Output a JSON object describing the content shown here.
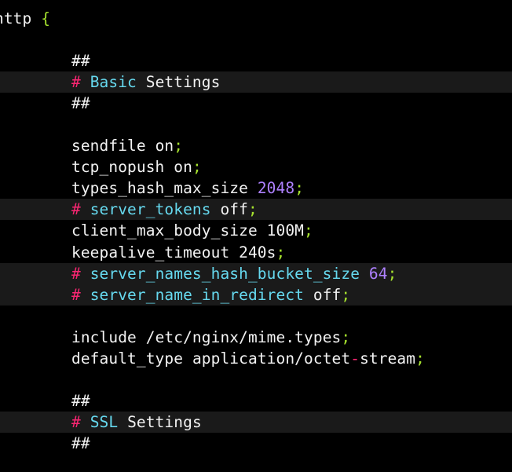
{
  "editor": {
    "lines": {
      "l1": {
        "text": "http",
        "brace": "{"
      },
      "l3": {
        "text": "##"
      },
      "l4": {
        "hash": "#",
        "kw": "Basic",
        "rest": "Settings"
      },
      "l5": {
        "text": "##"
      },
      "l7": {
        "name": "sendfile",
        "value": "on",
        "semi": ";"
      },
      "l8": {
        "name": "tcp_nopush",
        "value": "on",
        "semi": ";"
      },
      "l9": {
        "name": "types_hash_max_size",
        "value": "2048",
        "semi": ";"
      },
      "l10": {
        "hash": "#",
        "kw": "server_tokens",
        "value": "off",
        "semi": ";"
      },
      "l11": {
        "name": "client_max_body_size",
        "value": "100M",
        "semi": ";"
      },
      "l12": {
        "name": "keepalive_timeout",
        "value": "240s",
        "semi": ";"
      },
      "l13": {
        "hash": "#",
        "kw": "server_names_hash_bucket_size",
        "value": "64",
        "semi": ";"
      },
      "l14": {
        "hash": "#",
        "kw": "server_name_in_redirect",
        "value": "off",
        "semi": ";"
      },
      "l16": {
        "name": "include",
        "value": "/etc/nginx/mime.types",
        "semi": ";"
      },
      "l17": {
        "name": "default_type",
        "value_a": "application/octet",
        "dash": "-",
        "value_b": "stream",
        "semi": ";"
      },
      "l19": {
        "text": "##"
      },
      "l20": {
        "hash": "#",
        "kw": "SSL",
        "rest": "Settings"
      },
      "l21": {
        "text": "##"
      }
    }
  }
}
